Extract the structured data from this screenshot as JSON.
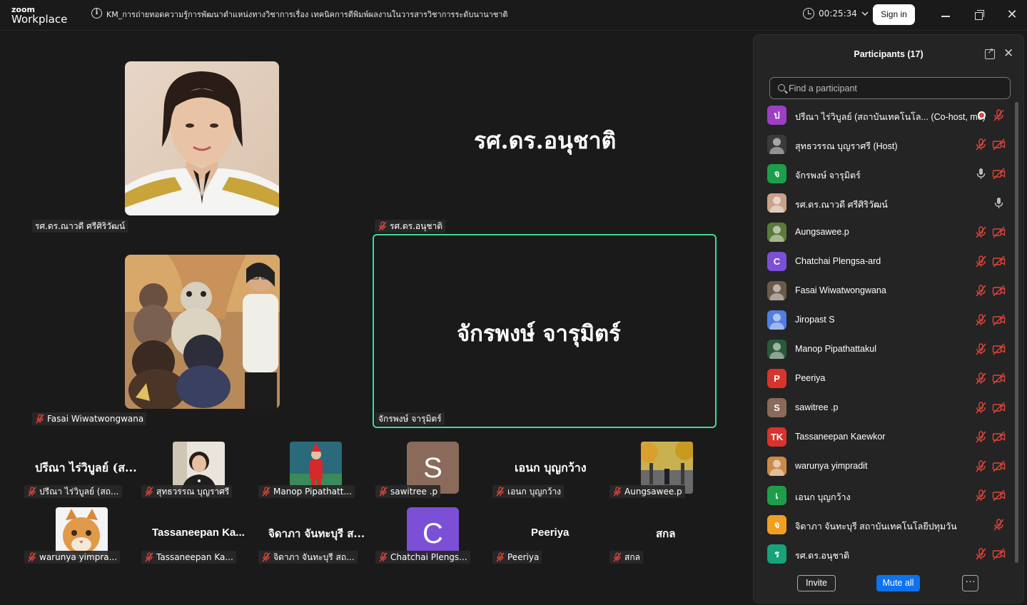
{
  "titlebar": {
    "logo_top": "zoom",
    "logo_bottom": "Workplace",
    "meeting_title": "KM_การถ่ายทอดความรู้การพัฒนาตำแหน่งทางวิชาการเรื่อง  เทคนิคการตีพิมพ์ผลงานในวารสารวิชาการระดับนานาชาติ",
    "timer": "00:25:34",
    "signin_label": "Sign in",
    "icons": [
      "info-icon",
      "clock-icon",
      "chevron-down-icon",
      "minimize-icon",
      "restore-icon",
      "close-icon"
    ]
  },
  "stage": {
    "tiles": {
      "t1_label": "รศ.ดร.ณาวดี ศรีศิริวัฒน์",
      "t2_bigname": "รศ.ดร.อนุชาติ",
      "t2_label": "รศ.ดร.อนุชาติ",
      "t3_label": "Fasai Wiwatwongwana",
      "t4_bigname": "จักรพงษ์ จารุมิตร์",
      "t4_label": "จักรพงษ์ จารุมิตร์"
    },
    "small_tiles": [
      {
        "bigname": "ปรีณา ไร่วิบูลย์ (ส...",
        "label": "ปรีณา ไร่วิบูลย์ (สถ..."
      },
      {
        "bigname": "",
        "label": "สุทธวรรณ บุญราศรี"
      },
      {
        "bigname": "",
        "label": "Manop Pipathatt..."
      },
      {
        "bigname": "S",
        "label": "sawitree .p"
      },
      {
        "bigname": "เอนก บุญกว้าง",
        "label": "เอนก บุญกว้าง"
      },
      {
        "bigname": "",
        "label": "Aungsawee.p"
      },
      {
        "bigname": "",
        "label": "warunya yimpra..."
      },
      {
        "bigname": "Tassaneepan Ka...",
        "label": "Tassaneepan Ka..."
      },
      {
        "bigname": "จิดาภา จันทะบุรี ส...",
        "label": "จิดาภา จันทะบุรี สถ..."
      },
      {
        "bigname": "C",
        "label": "Chatchai Plengs..."
      },
      {
        "bigname": "Peeriya",
        "label": "Peeriya"
      },
      {
        "bigname": "สกล",
        "label": "สกล"
      }
    ]
  },
  "panel": {
    "title": "Participants (17)",
    "search_placeholder": "Find a participant",
    "participants": [
      {
        "initial": "ป",
        "color": "#9b3fc4",
        "name": "ปรีณา ไร่วิบูลย์ (สถาบันเทคโนโล...  (Co-host, me)",
        "mic": "muted",
        "video": "none",
        "record": true
      },
      {
        "initial": "",
        "color": "#3a3a3a",
        "name": "สุทธวรรณ บุญราศรี (Host)",
        "mic": "muted",
        "video": "off"
      },
      {
        "initial": "จ",
        "color": "#1e9e4a",
        "name": "จักรพงษ์ จารุมิตร์",
        "mic": "on",
        "video": "off"
      },
      {
        "initial": "",
        "color": "#c9a28a",
        "name": "รศ.ดร.ณาวดี ศรีศิริวัฒน์",
        "mic": "on",
        "video": "none"
      },
      {
        "initial": "",
        "color": "#5b7a3a",
        "name": "Aungsawee.p",
        "mic": "muted",
        "video": "off"
      },
      {
        "initial": "C",
        "color": "#7b4fd6",
        "name": "Chatchai Plengsa-ard",
        "mic": "muted",
        "video": "off"
      },
      {
        "initial": "",
        "color": "#6b5a4a",
        "name": "Fasai Wiwatwongwana",
        "mic": "muted",
        "video": "off"
      },
      {
        "initial": "",
        "color": "#4f7fe0",
        "name": "Jiropast S",
        "mic": "muted",
        "video": "off"
      },
      {
        "initial": "",
        "color": "#2a5a3a",
        "name": "Manop Pipathattakul",
        "mic": "muted",
        "video": "off"
      },
      {
        "initial": "P",
        "color": "#d8342c",
        "name": "Peeriya",
        "mic": "muted",
        "video": "off"
      },
      {
        "initial": "S",
        "color": "#8a6a5a",
        "name": "sawitree .p",
        "mic": "muted",
        "video": "off"
      },
      {
        "initial": "TK",
        "color": "#d8342c",
        "name": "Tassaneepan Kaewkor",
        "mic": "muted",
        "video": "off"
      },
      {
        "initial": "",
        "color": "#c98a4a",
        "name": "warunya yimpradit",
        "mic": "muted",
        "video": "off"
      },
      {
        "initial": "เ",
        "color": "#1e9e4a",
        "name": "เอนก บุญกว้าง",
        "mic": "muted",
        "video": "off"
      },
      {
        "initial": "จ",
        "color": "#f0a020",
        "name": "จิดาภา จันทะบุรี สถาบันเทคโนโลยีปทุมวัน",
        "mic": "muted",
        "video": "none"
      },
      {
        "initial": "ร",
        "color": "#17a27a",
        "name": "รศ.ดร.อนุชาติ",
        "mic": "muted",
        "video": "off"
      }
    ],
    "invite_label": "Invite",
    "muteall_label": "Mute all",
    "more_label": "···"
  }
}
